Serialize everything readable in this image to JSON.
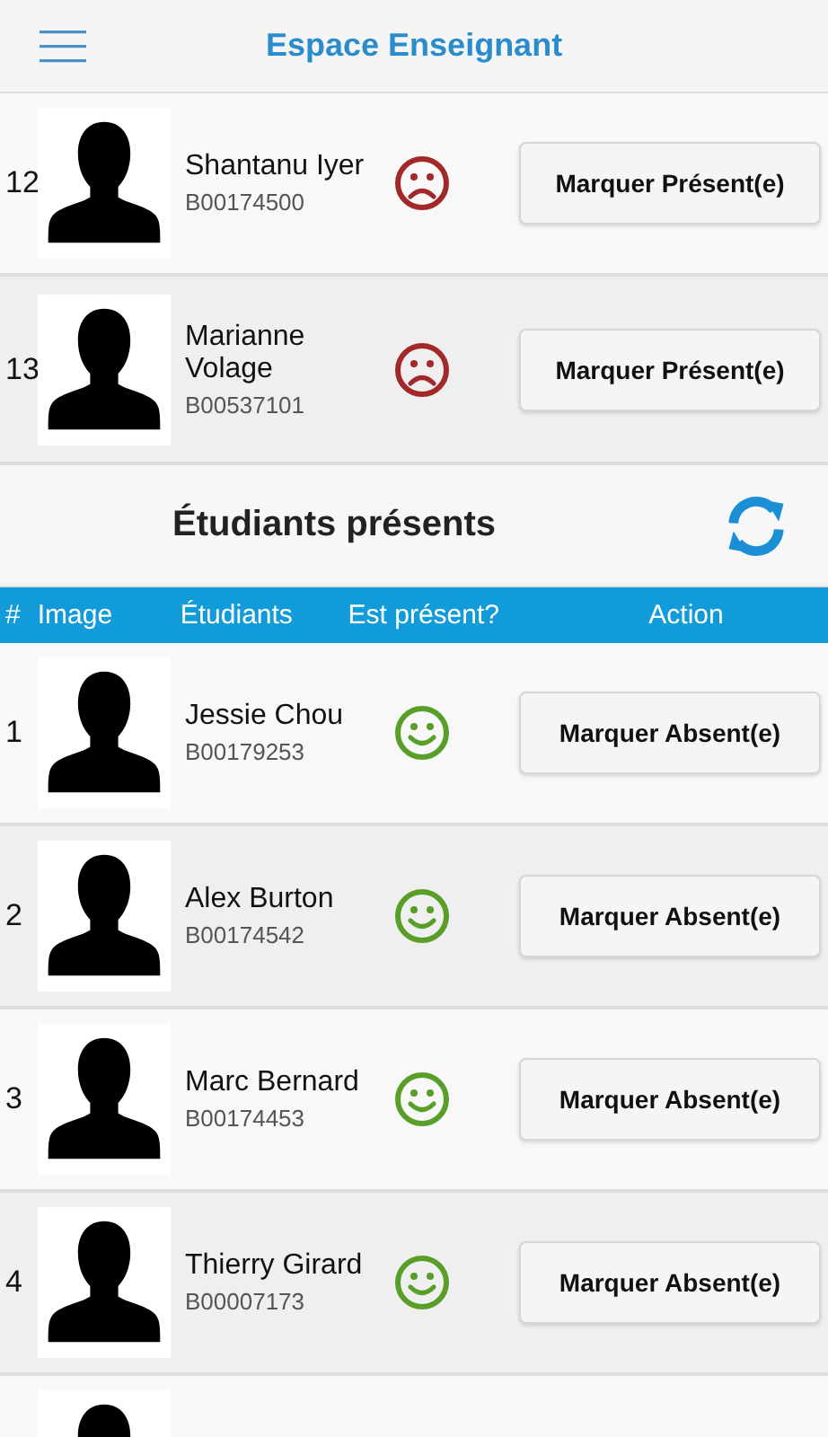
{
  "header": {
    "title": "Espace Enseignant"
  },
  "absent_students": [
    {
      "number": "12",
      "name": "Shantanu Iyer",
      "id": "B00174500",
      "present": false,
      "action": "Marquer Présent(e)"
    },
    {
      "number": "13",
      "name": "Marianne Volage",
      "id": "B00537101",
      "present": false,
      "action": "Marquer Présent(e)"
    }
  ],
  "present_section": {
    "title": "Étudiants présents"
  },
  "table": {
    "columns": [
      "#",
      "Image",
      "Étudiants",
      "Est présent?",
      "Action"
    ],
    "rows": [
      {
        "number": "1",
        "name": "Jessie Chou",
        "id": "B00179253",
        "present": true,
        "action": "Marquer Absent(e)"
      },
      {
        "number": "2",
        "name": "Alex Burton",
        "id": "B00174542",
        "present": true,
        "action": "Marquer Absent(e)"
      },
      {
        "number": "3",
        "name": "Marc Bernard",
        "id": "B00174453",
        "present": true,
        "action": "Marquer Absent(e)"
      },
      {
        "number": "4",
        "name": "Thierry Girard",
        "id": "B00007173",
        "present": true,
        "action": "Marquer Absent(e)"
      }
    ]
  }
}
